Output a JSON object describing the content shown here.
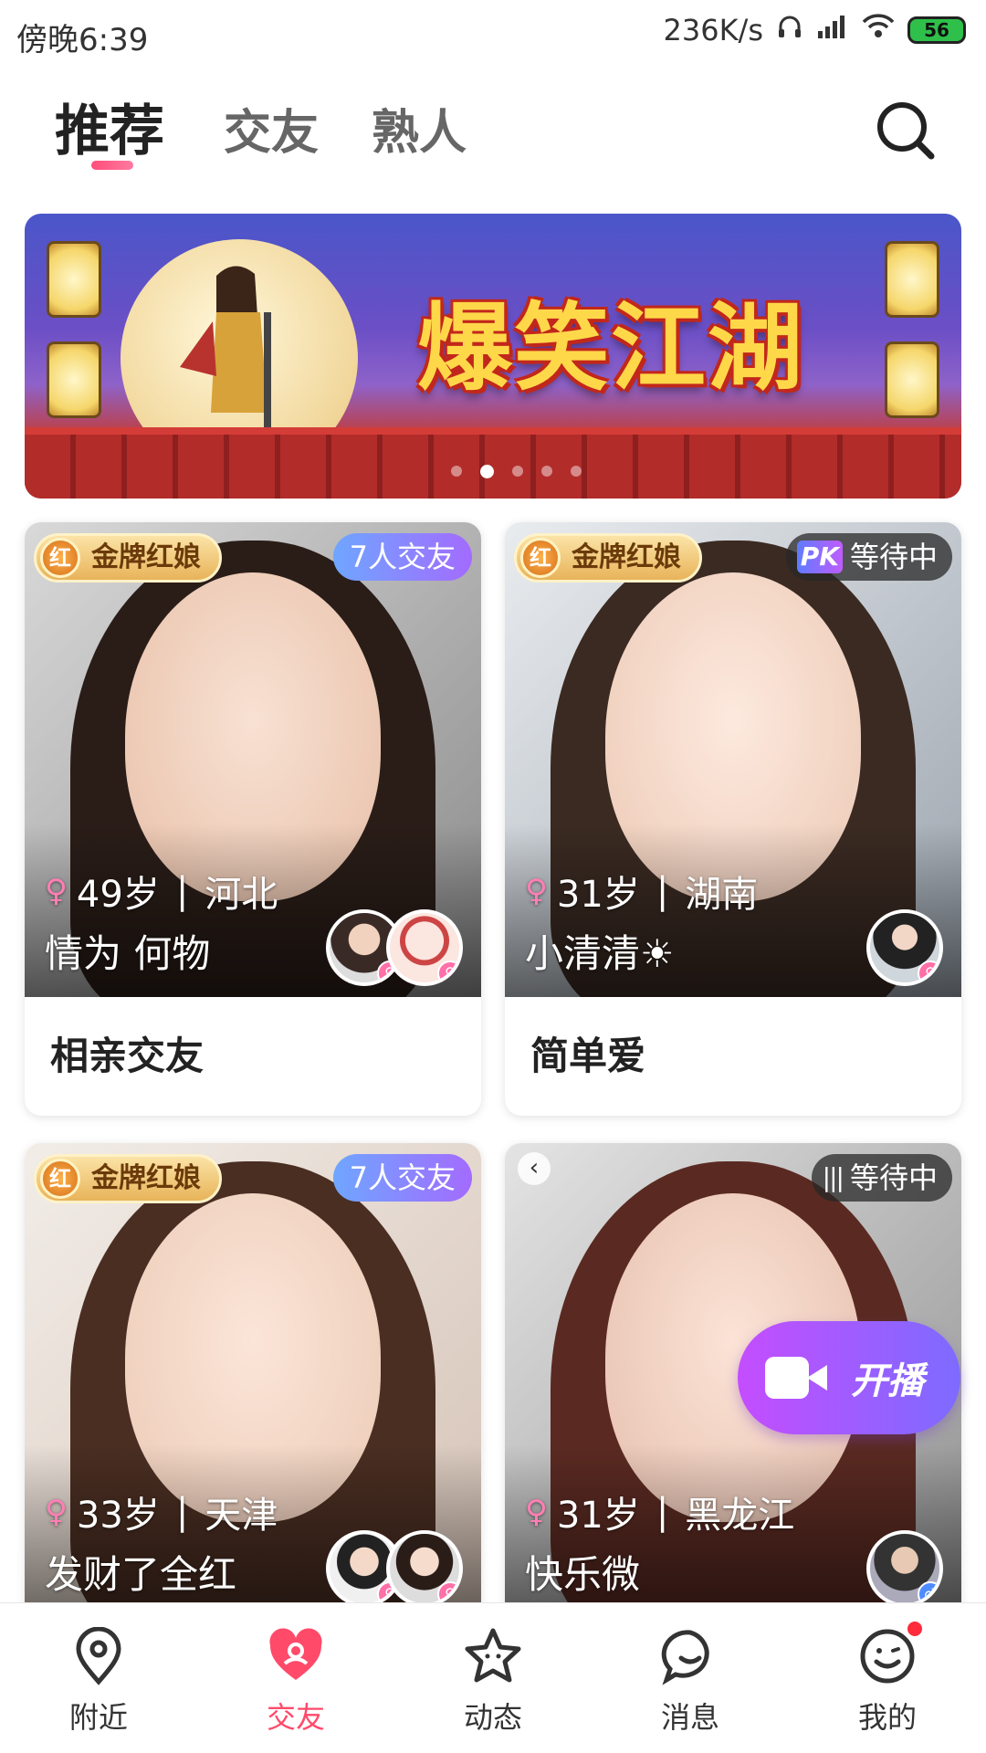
{
  "status_bar": {
    "time": "傍晚6:39",
    "speed": "236K/s",
    "battery": "56"
  },
  "tabs": [
    {
      "label": "推荐"
    },
    {
      "label": "交友"
    },
    {
      "label": "熟人"
    }
  ],
  "banner": {
    "title": "爆笑江湖"
  },
  "cards": [
    {
      "badge": "金牌红娘",
      "tag": "7人交友",
      "age": "49岁",
      "region": "河北",
      "nickname": "情为 何物",
      "caption": "相亲交友"
    },
    {
      "badge": "金牌红娘",
      "tag_icon": "PK",
      "tag": "等待中",
      "age": "31岁",
      "region": "湖南",
      "nickname": "小清清☀",
      "caption": "简单爱"
    },
    {
      "badge": "金牌红娘",
      "tag": "7人交友",
      "age": "33岁",
      "region": "天津",
      "nickname": "发财了全红"
    },
    {
      "tag": "等待中",
      "age": "31岁",
      "region": "黑龙江",
      "nickname": "快乐微"
    }
  ],
  "live_button": {
    "label": "开播"
  },
  "bottom_nav": [
    {
      "label": "附近"
    },
    {
      "label": "交友"
    },
    {
      "label": "动态"
    },
    {
      "label": "消息"
    },
    {
      "label": "我的"
    }
  ]
}
